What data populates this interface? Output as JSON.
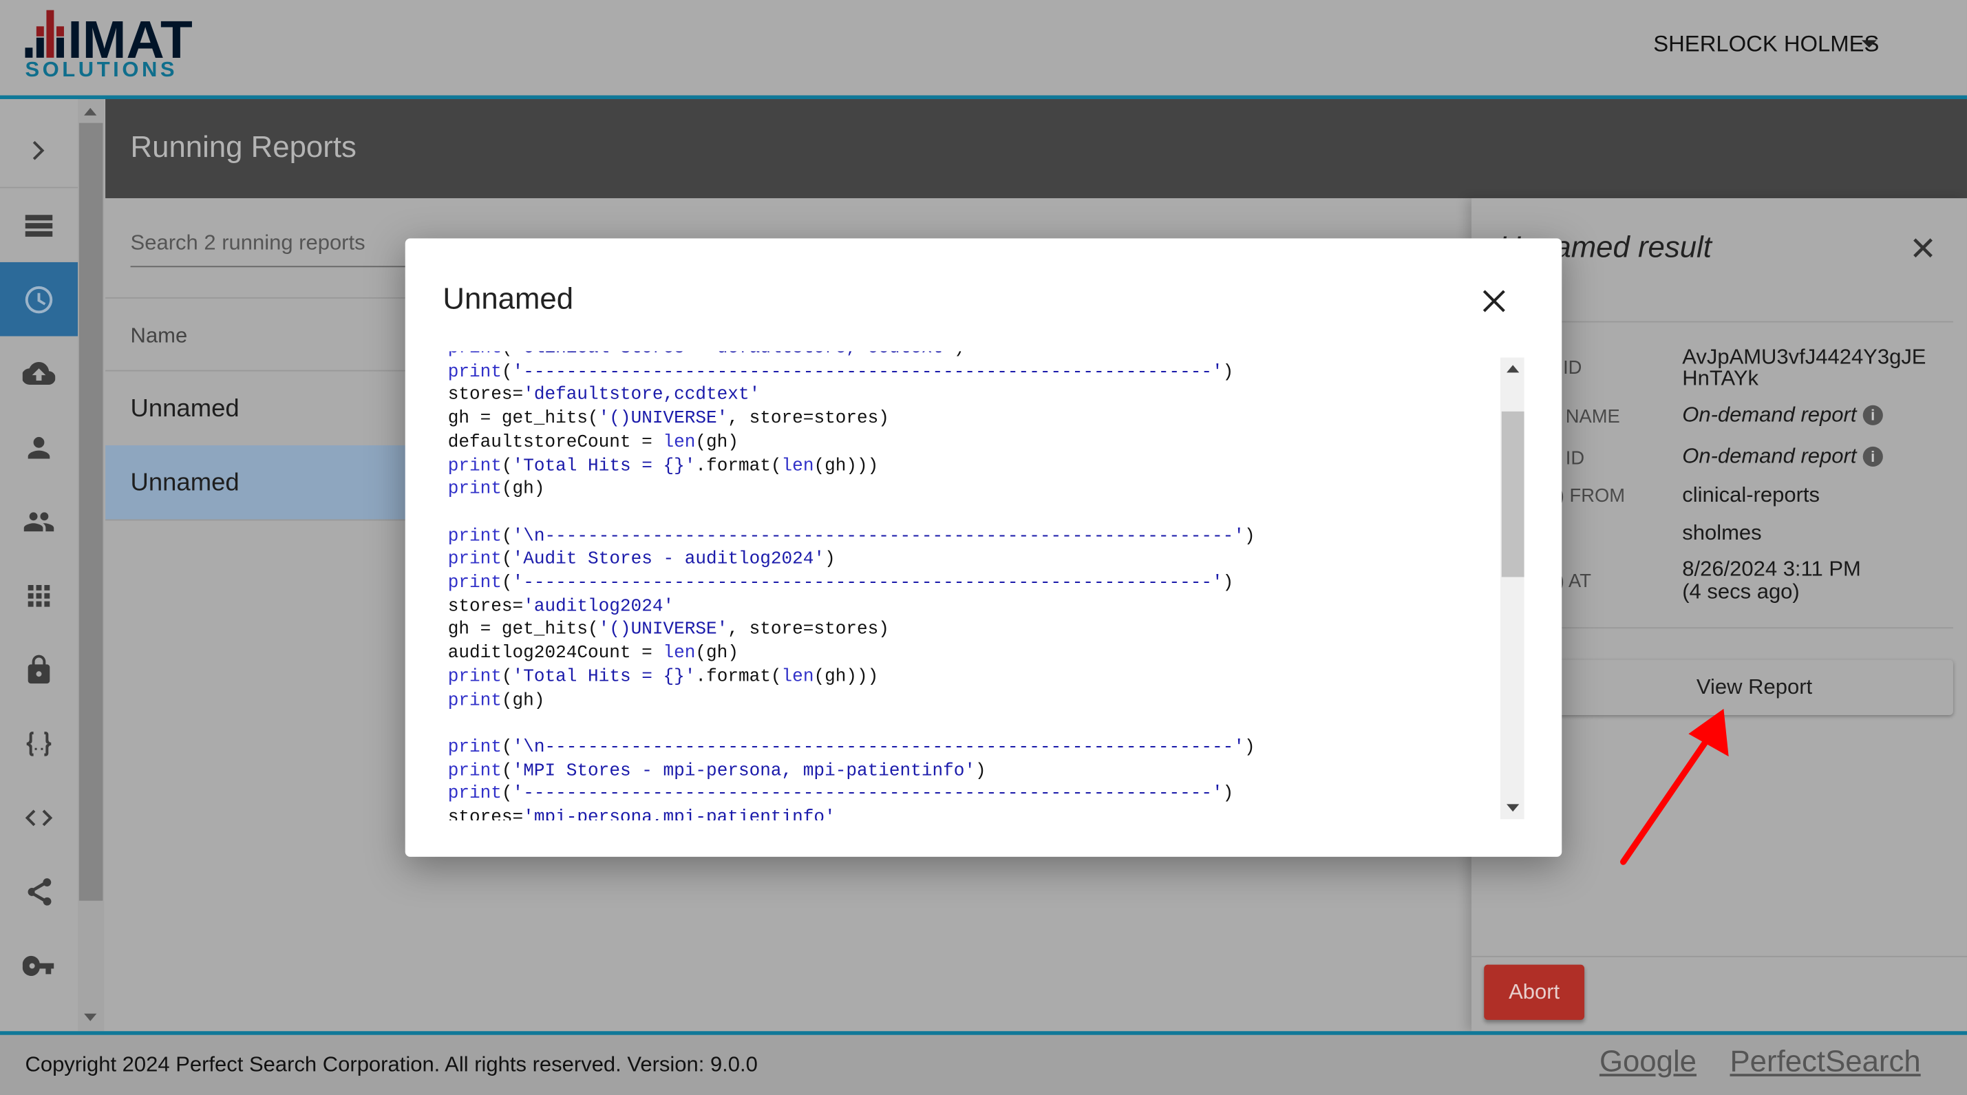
{
  "header": {
    "logo_text": "IMAT SOLUTIONS",
    "user_name": "SHERLOCK HOLMES"
  },
  "sidebar": {
    "items": [
      {
        "icon": "chevron-right-icon",
        "label": "expand"
      },
      {
        "icon": "list-icon"
      },
      {
        "icon": "clock-icon",
        "active": true
      },
      {
        "icon": "cloud-upload-icon"
      },
      {
        "icon": "person-icon"
      },
      {
        "icon": "people-icon"
      },
      {
        "icon": "apps-grid-icon"
      },
      {
        "icon": "lock-icon"
      },
      {
        "icon": "braces-icon"
      },
      {
        "icon": "code-icon"
      },
      {
        "icon": "share-icon"
      },
      {
        "icon": "key-icon"
      }
    ]
  },
  "main": {
    "title": "Running Reports",
    "search_placeholder": "Search 2 running reports",
    "column_name": "Name",
    "rows": [
      {
        "name": "Unnamed"
      },
      {
        "name": "Unnamed",
        "selected": true
      }
    ]
  },
  "details": {
    "title": "Unnamed result",
    "fields": [
      {
        "label": "ID",
        "value": "AvJpAMU3vfJ4424Y3gJE HnTAYk"
      },
      {
        "label": "NAME",
        "value": "On-demand report",
        "info": true
      },
      {
        "label": "ID",
        "value": "On-demand report",
        "info": true
      },
      {
        "label": ") FROM",
        "value": "clinical-reports"
      },
      {
        "label": "",
        "value": "sholmes"
      },
      {
        "label": ") AT",
        "value": "8/26/2024 3:11 PM",
        "value2": "(4 secs ago)"
      }
    ],
    "view_report_label": "View Report",
    "abort_label": "Abort"
  },
  "modal": {
    "title": "Unnamed",
    "code_lines": [
      [
        [
          "k",
          "print"
        ],
        [
          "p",
          "("
        ],
        [
          "s",
          "'Clinical Stores - defaultstore, ccdtext'"
        ],
        [
          "p",
          ")"
        ]
      ],
      [
        [
          "k",
          "print"
        ],
        [
          "p",
          "("
        ],
        [
          "s",
          "'----------------------------------------------------------------'"
        ],
        [
          "p",
          ")"
        ]
      ],
      [
        [
          "p",
          "stores="
        ],
        [
          "s",
          "'defaultstore,ccdtext'"
        ]
      ],
      [
        [
          "p",
          "gh = get_hits("
        ],
        [
          "s",
          "'()UNIVERSE'"
        ],
        [
          "p",
          ", store=stores)"
        ]
      ],
      [
        [
          "p",
          "defaultstoreCount = "
        ],
        [
          "k",
          "len"
        ],
        [
          "p",
          "(gh)"
        ]
      ],
      [
        [
          "k",
          "print"
        ],
        [
          "p",
          "("
        ],
        [
          "s",
          "'Total Hits = {}'"
        ],
        [
          "p",
          ".format("
        ],
        [
          "k",
          "len"
        ],
        [
          "p",
          "(gh)))"
        ]
      ],
      [
        [
          "k",
          "print"
        ],
        [
          "p",
          "(gh)"
        ]
      ],
      [],
      [
        [
          "k",
          "print"
        ],
        [
          "p",
          "("
        ],
        [
          "s",
          "'\\n----------------------------------------------------------------'"
        ],
        [
          "p",
          ")"
        ]
      ],
      [
        [
          "k",
          "print"
        ],
        [
          "p",
          "("
        ],
        [
          "s",
          "'Audit Stores - auditlog2024'"
        ],
        [
          "p",
          ")"
        ]
      ],
      [
        [
          "k",
          "print"
        ],
        [
          "p",
          "("
        ],
        [
          "s",
          "'----------------------------------------------------------------'"
        ],
        [
          "p",
          ")"
        ]
      ],
      [
        [
          "p",
          "stores="
        ],
        [
          "s",
          "'auditlog2024'"
        ]
      ],
      [
        [
          "p",
          "gh = get_hits("
        ],
        [
          "s",
          "'()UNIVERSE'"
        ],
        [
          "p",
          ", store=stores)"
        ]
      ],
      [
        [
          "p",
          "auditlog2024Count = "
        ],
        [
          "k",
          "len"
        ],
        [
          "p",
          "(gh)"
        ]
      ],
      [
        [
          "k",
          "print"
        ],
        [
          "p",
          "("
        ],
        [
          "s",
          "'Total Hits = {}'"
        ],
        [
          "p",
          ".format("
        ],
        [
          "k",
          "len"
        ],
        [
          "p",
          "(gh)))"
        ]
      ],
      [
        [
          "k",
          "print"
        ],
        [
          "p",
          "(gh)"
        ]
      ],
      [],
      [
        [
          "k",
          "print"
        ],
        [
          "p",
          "("
        ],
        [
          "s",
          "'\\n----------------------------------------------------------------'"
        ],
        [
          "p",
          ")"
        ]
      ],
      [
        [
          "k",
          "print"
        ],
        [
          "p",
          "("
        ],
        [
          "s",
          "'MPI Stores - mpi-persona, mpi-patientinfo'"
        ],
        [
          "p",
          ")"
        ]
      ],
      [
        [
          "k",
          "print"
        ],
        [
          "p",
          "("
        ],
        [
          "s",
          "'----------------------------------------------------------------'"
        ],
        [
          "p",
          ")"
        ]
      ],
      [
        [
          "p",
          "stores="
        ],
        [
          "s",
          "'mpi-persona,mpi-patientinfo'"
        ]
      ]
    ]
  },
  "footer": {
    "copyright": "Copyright 2024 Perfect Search Corporation. All rights reserved. Version: 9.0.0",
    "links": [
      "Google",
      "PerfectSearch"
    ]
  },
  "colors": {
    "accent": "#0f7898",
    "abort": "#b02f27",
    "annotation_arrow": "#ff0000",
    "code_keyword": "#3030c8",
    "code_string": "#1a1aaa"
  }
}
